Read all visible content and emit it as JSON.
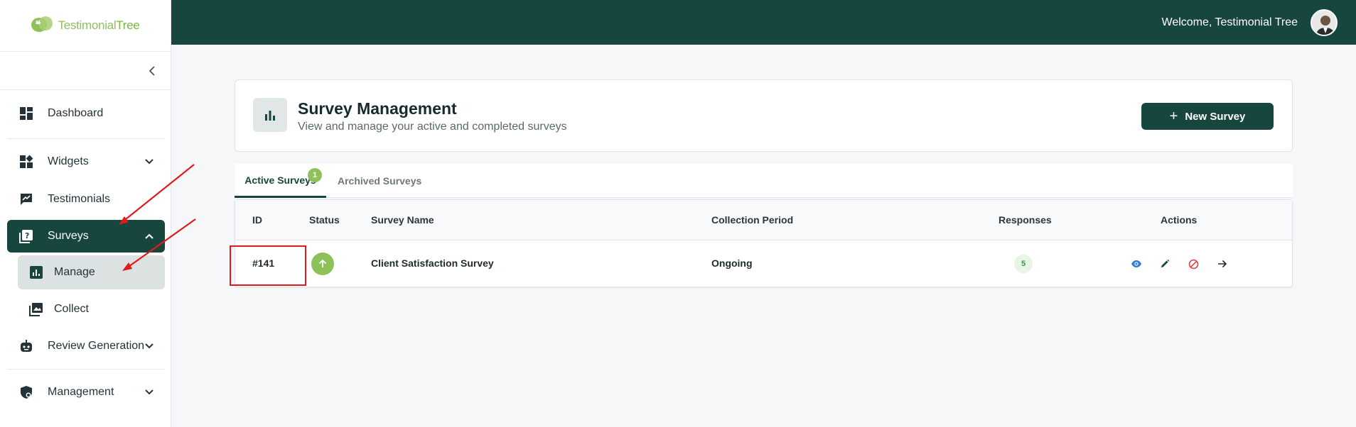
{
  "brand": {
    "logo_text_a": "Testimonial",
    "logo_text_b": "Tree"
  },
  "topbar": {
    "welcome": "Welcome, Testimonial Tree"
  },
  "sidebar": {
    "items": [
      {
        "label": "Dashboard",
        "icon": "dashboard-icon"
      },
      {
        "label": "Widgets",
        "icon": "widgets-icon"
      },
      {
        "label": "Testimonials",
        "icon": "testimonials-icon"
      },
      {
        "label": "Surveys",
        "icon": "surveys-icon",
        "active": true
      },
      {
        "label": "Manage",
        "icon": "manage-icon",
        "sub": true,
        "active": true
      },
      {
        "label": "Collect",
        "icon": "collect-icon",
        "sub": true
      },
      {
        "label": "Review Generation",
        "icon": "robot-icon"
      },
      {
        "label": "Management",
        "icon": "shield-icon"
      }
    ]
  },
  "header": {
    "title": "Survey Management",
    "subtitle": "View and manage your active and completed surveys",
    "new_button": "New Survey"
  },
  "tabs": [
    {
      "label": "Active Surveys",
      "badge": "1",
      "active": true
    },
    {
      "label": "Archived Surveys"
    }
  ],
  "table": {
    "columns": [
      "ID",
      "Status",
      "Survey Name",
      "Collection Period",
      "Responses",
      "Actions"
    ],
    "rows": [
      {
        "id": "#141",
        "status": "active",
        "name": "Client Satisfaction Survey",
        "period": "Ongoing",
        "responses": "5"
      }
    ]
  },
  "colors": {
    "primary": "#17463f",
    "accent": "#8fc15a",
    "annotation": "#e01b1b"
  }
}
